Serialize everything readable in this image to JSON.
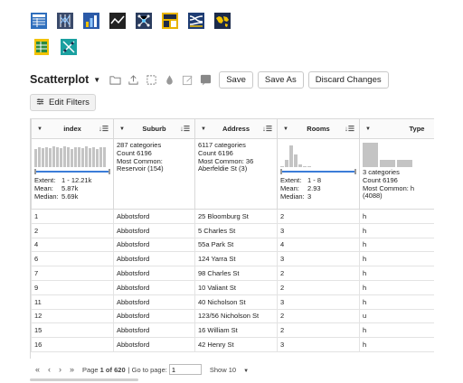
{
  "viz_icons": [
    {
      "name": "table-icon",
      "color": "#2f6fbd"
    },
    {
      "name": "parallel-coordinates-icon",
      "color": "#3a4a6b"
    },
    {
      "name": "bar-chart-icon",
      "color": "#2b5aa8"
    },
    {
      "name": "line-chart-icon",
      "color": "#222222"
    },
    {
      "name": "network-icon",
      "color": "#2a3c5e"
    },
    {
      "name": "dashboard-icon",
      "color": "#e8b400"
    },
    {
      "name": "sankey-icon",
      "color": "#1f3d73"
    },
    {
      "name": "world-map-icon",
      "color": "#1b2a4a"
    },
    {
      "name": "spreadsheet-icon",
      "color": "#2e8b3e"
    },
    {
      "name": "scatter-tool-icon",
      "color": "#1aa0a0"
    }
  ],
  "toolbar": {
    "viz_type": "Scatterplot",
    "notification_count": "2",
    "save_label": "Save",
    "save_as_label": "Save As",
    "discard_label": "Discard Changes"
  },
  "edit_filters_label": "Edit Filters",
  "columns": [
    {
      "label": "index",
      "type": "numeric",
      "histogram": [
        0.7,
        0.78,
        0.74,
        0.8,
        0.76,
        0.82,
        0.79,
        0.75,
        0.81,
        0.77,
        0.73,
        0.8,
        0.78,
        0.74,
        0.83,
        0.76,
        0.79,
        0.72,
        0.8,
        0.77
      ],
      "stats": [
        {
          "key": "Extent:",
          "value": "1 - 12.21k"
        },
        {
          "key": "Mean:",
          "value": "5.87k"
        },
        {
          "key": "Median:",
          "value": "5.69k"
        }
      ]
    },
    {
      "label": "Suburb",
      "type": "categorical",
      "summary": [
        "287 categories",
        "Count 6196",
        "Most Common:",
        "Reservoir (154)"
      ]
    },
    {
      "label": "Address",
      "type": "categorical",
      "summary": [
        "6117 categories",
        "Count 6196",
        "Most Common: 36",
        "Aberfeldie St (3)"
      ]
    },
    {
      "label": "Rooms",
      "type": "numeric",
      "histogram": [
        0.05,
        0.3,
        0.85,
        0.5,
        0.12,
        0.04,
        0.02,
        0.01
      ],
      "stats": [
        {
          "key": "Extent:",
          "value": "1 - 8"
        },
        {
          "key": "Mean:",
          "value": "2.93"
        },
        {
          "key": "Median:",
          "value": "3"
        }
      ]
    },
    {
      "label": "Type",
      "type": "categorical",
      "histogram": [
        0.95,
        0.3,
        0.3
      ],
      "summary": [
        "3 categories",
        "Count 6196",
        "Most Common: h",
        "(4088)"
      ]
    }
  ],
  "rows": [
    [
      "1",
      "Abbotsford",
      "25 Bloomburg St",
      "2",
      "h"
    ],
    [
      "2",
      "Abbotsford",
      "5 Charles St",
      "3",
      "h"
    ],
    [
      "4",
      "Abbotsford",
      "55a Park St",
      "4",
      "h"
    ],
    [
      "6",
      "Abbotsford",
      "124 Yarra St",
      "3",
      "h"
    ],
    [
      "7",
      "Abbotsford",
      "98 Charles St",
      "2",
      "h"
    ],
    [
      "9",
      "Abbotsford",
      "10 Valiant St",
      "2",
      "h"
    ],
    [
      "11",
      "Abbotsford",
      "40 Nicholson St",
      "3",
      "h"
    ],
    [
      "12",
      "Abbotsford",
      "123/56 Nicholson St",
      "2",
      "u"
    ],
    [
      "15",
      "Abbotsford",
      "16 William St",
      "2",
      "h"
    ],
    [
      "16",
      "Abbotsford",
      "42 Henry St",
      "3",
      "h"
    ]
  ],
  "pager": {
    "page_text_prefix": "Page",
    "current_page": "1",
    "of_text": "of",
    "total_pages": "620",
    "goto_label": "| Go to page:",
    "goto_value": "1",
    "show_label": "Show 10"
  }
}
